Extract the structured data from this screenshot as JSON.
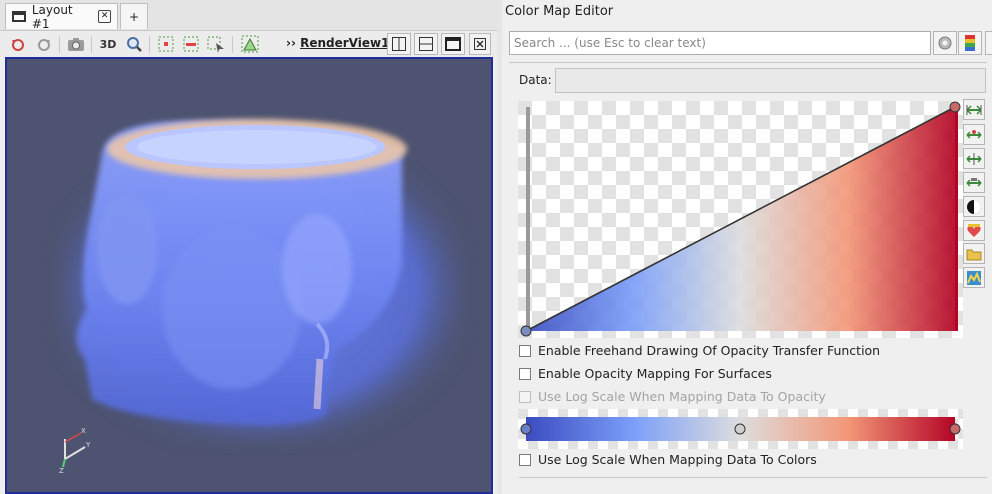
{
  "layout_tabs": {
    "active_label": "Layout #1",
    "add_label": "+"
  },
  "toolbar": {
    "label_3d": "3D",
    "render_view_label": "RenderView1",
    "chevrons": "››"
  },
  "color_map_editor": {
    "title": "Color Map Editor",
    "search": {
      "placeholder": "Search ... (use Esc to clear text)",
      "value": ""
    },
    "data_label": "Data:",
    "data_value": "",
    "options": {
      "freehand_opacity": "Enable Freehand Drawing Of Opacity Transfer Function",
      "opacity_surfaces": "Enable Opacity Mapping For Surfaces",
      "log_opacity": "Use Log Scale When Mapping Data To Opacity",
      "log_colors": "Use Log Scale When Mapping Data To Colors"
    },
    "colormap": {
      "preset": "Cool to Warm",
      "low_color": "#3b4cc0",
      "mid_color": "#dddddd",
      "high_color": "#b40426"
    },
    "opacity_function": {
      "min_opacity": 0,
      "max_opacity": 1
    }
  },
  "colors": {
    "view_border": "#1f2e9a",
    "view_background": "#4d5370"
  }
}
